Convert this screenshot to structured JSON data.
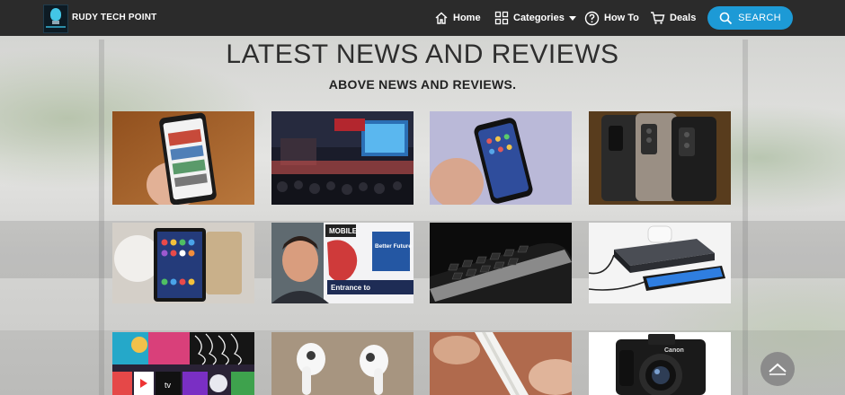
{
  "navbar": {
    "brand": "RUDY TECH POINT",
    "items": [
      {
        "label": "Home",
        "icon": "home-icon"
      },
      {
        "label": "Categories",
        "icon": "grid-icon"
      },
      {
        "label": "How To",
        "icon": "question-icon"
      },
      {
        "label": "Deals",
        "icon": "cart-icon"
      }
    ],
    "search_label": "SEARCH"
  },
  "main": {
    "title": "LATEST NEWS AND REVIEWS",
    "subtitle": "ABOVE NEWS AND REVIEWS."
  },
  "articles": [
    {
      "image": "phone-in-hand-news-app"
    },
    {
      "image": "huawei-expo-booth"
    },
    {
      "image": "foldable-phone-in-hand"
    },
    {
      "image": "phones-back-camera"
    },
    {
      "image": "foldable-tablet-on-table"
    },
    {
      "image": "man-at-mobile-expo",
      "text": [
        "MOBILE",
        "Better Future",
        "Entrance to"
      ]
    },
    {
      "image": "slide-out-keyboard-phone"
    },
    {
      "image": "charging-dock-with-phone"
    },
    {
      "image": "smart-tv-apps",
      "text": [
        "tv"
      ]
    },
    {
      "image": "wireless-earbuds"
    },
    {
      "image": "stylus-pen-in-hand"
    },
    {
      "image": "mirrorless-camera",
      "text": [
        "Canon"
      ]
    }
  ],
  "colors": {
    "navbar_bg": "#2b2b2b",
    "search_bg": "#1d9ad6",
    "title": "#2e2e2e"
  }
}
